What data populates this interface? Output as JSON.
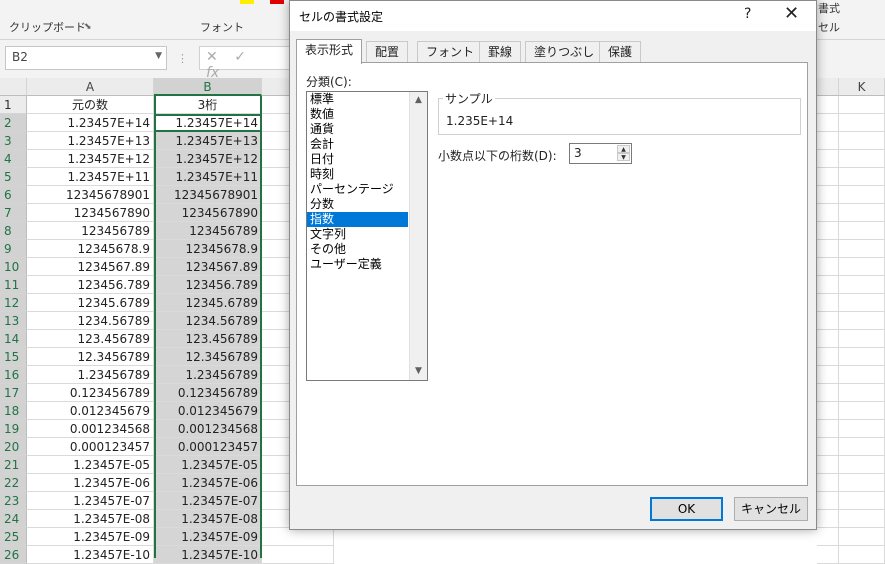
{
  "ribbon": {
    "clipboard_label": "クリップボード",
    "font_label": "フォント",
    "format_label": "書式",
    "cell_label": "セル"
  },
  "formula_bar": {
    "name_box": "B2",
    "cancel_glyph": "✕",
    "enter_glyph": "✓",
    "fx_glyph": "fx"
  },
  "sheet": {
    "columns": [
      "A",
      "B",
      "K"
    ],
    "headers": {
      "a": "元の数",
      "b": "3桁"
    },
    "rows": [
      {
        "n": "1"
      },
      {
        "n": "2",
        "a": "1.23457E+14",
        "b": "1.23457E+14"
      },
      {
        "n": "3",
        "a": "1.23457E+13",
        "b": "1.23457E+13"
      },
      {
        "n": "4",
        "a": "1.23457E+12",
        "b": "1.23457E+12"
      },
      {
        "n": "5",
        "a": "1.23457E+11",
        "b": "1.23457E+11"
      },
      {
        "n": "6",
        "a": "12345678901",
        "b": "12345678901"
      },
      {
        "n": "7",
        "a": "1234567890",
        "b": "1234567890"
      },
      {
        "n": "8",
        "a": "123456789",
        "b": "123456789"
      },
      {
        "n": "9",
        "a": "12345678.9",
        "b": "12345678.9"
      },
      {
        "n": "10",
        "a": "1234567.89",
        "b": "1234567.89"
      },
      {
        "n": "11",
        "a": "123456.789",
        "b": "123456.789"
      },
      {
        "n": "12",
        "a": "12345.6789",
        "b": "12345.6789"
      },
      {
        "n": "13",
        "a": "1234.56789",
        "b": "1234.56789"
      },
      {
        "n": "14",
        "a": "123.456789",
        "b": "123.456789"
      },
      {
        "n": "15",
        "a": "12.3456789",
        "b": "12.3456789"
      },
      {
        "n": "16",
        "a": "1.23456789",
        "b": "1.23456789"
      },
      {
        "n": "17",
        "a": "0.123456789",
        "b": "0.123456789"
      },
      {
        "n": "18",
        "a": "0.012345679",
        "b": "0.012345679"
      },
      {
        "n": "19",
        "a": "0.001234568",
        "b": "0.001234568"
      },
      {
        "n": "20",
        "a": "0.000123457",
        "b": "0.000123457"
      },
      {
        "n": "21",
        "a": "1.23457E-05",
        "b": "1.23457E-05"
      },
      {
        "n": "22",
        "a": "1.23457E-06",
        "b": "1.23457E-06"
      },
      {
        "n": "23",
        "a": "1.23457E-07",
        "b": "1.23457E-07"
      },
      {
        "n": "24",
        "a": "1.23457E-08",
        "b": "1.23457E-08"
      },
      {
        "n": "25",
        "a": "1.23457E-09",
        "b": "1.23457E-09"
      },
      {
        "n": "26",
        "a": "1.23457E-10",
        "b": "1.23457E-10"
      }
    ]
  },
  "dialog": {
    "title": "セルの書式設定",
    "help": "?",
    "close": "✕",
    "tabs": [
      "表示形式",
      "配置",
      "フォント",
      "罫線",
      "塗りつぶし",
      "保護"
    ],
    "category_label": "分類(C):",
    "categories": [
      "標準",
      "数値",
      "通貨",
      "会計",
      "日付",
      "時刻",
      "パーセンテージ",
      "分数",
      "指数",
      "文字列",
      "その他",
      "ユーザー定義"
    ],
    "selected_category": "指数",
    "sample_label": "サンプル",
    "sample_value": "1.235E+14",
    "decimal_label": "小数点以下の桁数(D):",
    "decimal_value": "3",
    "ok": "OK",
    "cancel": "キャンセル"
  },
  "colors": {
    "accent": "#217346",
    "selection": "#0078d7"
  }
}
